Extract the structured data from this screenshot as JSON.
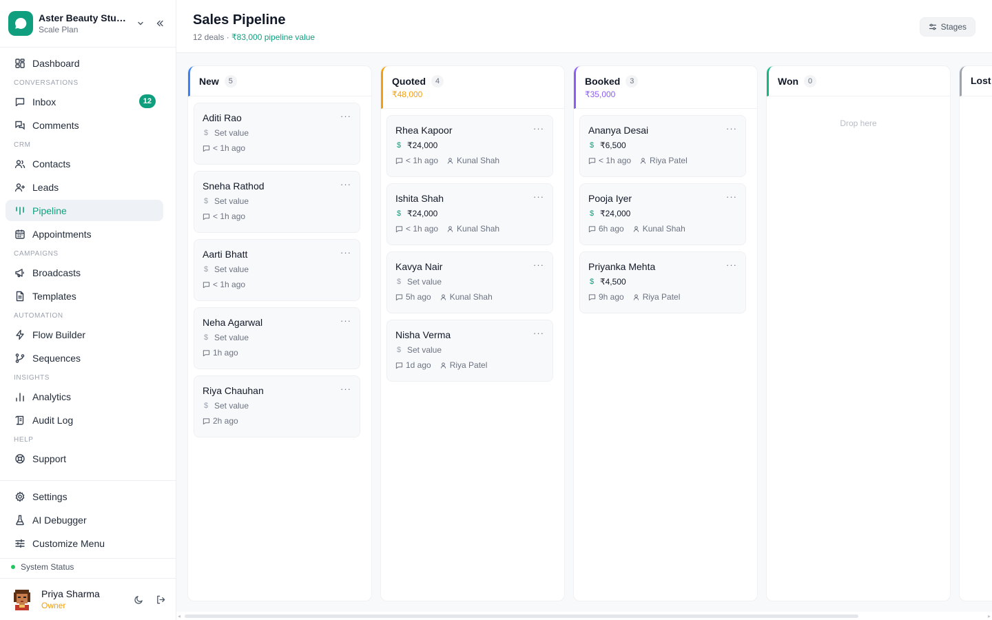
{
  "brand": {
    "name": "Aster Beauty Studio",
    "plan": "Scale Plan"
  },
  "nav": {
    "dashboard": "Dashboard",
    "sec_conversations": "CONVERSATIONS",
    "inbox": "Inbox",
    "inbox_badge": "12",
    "comments": "Comments",
    "sec_crm": "CRM",
    "contacts": "Contacts",
    "leads": "Leads",
    "pipeline": "Pipeline",
    "appointments": "Appointments",
    "sec_campaigns": "CAMPAIGNS",
    "broadcasts": "Broadcasts",
    "templates": "Templates",
    "sec_automation": "AUTOMATION",
    "flow_builder": "Flow Builder",
    "sequences": "Sequences",
    "sec_insights": "INSIGHTS",
    "analytics": "Analytics",
    "audit_log": "Audit Log",
    "sec_help": "HELP",
    "support": "Support",
    "settings": "Settings",
    "ai_debugger": "AI Debugger",
    "customize_menu": "Customize Menu"
  },
  "system_status": "System Status",
  "user": {
    "name": "Priya Sharma",
    "role": "Owner"
  },
  "header": {
    "title": "Sales Pipeline",
    "deals": "12 deals",
    "dot": " · ",
    "pipeline_value": "₹83,000 pipeline value",
    "stages_label": "Stages"
  },
  "columns": [
    {
      "title": "New",
      "count": "5",
      "total": "",
      "color": "#3b82f6",
      "drop_text": "",
      "cards": [
        {
          "name": "Aditi Rao",
          "value": "Set value",
          "time": "< 1h ago",
          "owner": ""
        },
        {
          "name": "Sneha Rathod",
          "value": "Set value",
          "time": "< 1h ago",
          "owner": ""
        },
        {
          "name": "Aarti Bhatt",
          "value": "Set value",
          "time": "< 1h ago",
          "owner": ""
        },
        {
          "name": "Neha Agarwal",
          "value": "Set value",
          "time": "1h ago",
          "owner": ""
        },
        {
          "name": "Riya Chauhan",
          "value": "Set value",
          "time": "2h ago",
          "owner": ""
        }
      ]
    },
    {
      "title": "Quoted",
      "count": "4",
      "total": "₹48,000",
      "color": "#f59e0b",
      "drop_text": "",
      "cards": [
        {
          "name": "Rhea Kapoor",
          "value": "₹24,000",
          "time": "< 1h ago",
          "owner": "Kunal Shah"
        },
        {
          "name": "Ishita Shah",
          "value": "₹24,000",
          "time": "< 1h ago",
          "owner": "Kunal Shah"
        },
        {
          "name": "Kavya Nair",
          "value": "Set value",
          "time": "5h ago",
          "owner": "Kunal Shah"
        },
        {
          "name": "Nisha Verma",
          "value": "Set value",
          "time": "1d ago",
          "owner": "Riya Patel"
        }
      ]
    },
    {
      "title": "Booked",
      "count": "3",
      "total": "₹35,000",
      "color": "#8b5cf6",
      "drop_text": "",
      "cards": [
        {
          "name": "Ananya Desai",
          "value": "₹6,500",
          "time": "< 1h ago",
          "owner": "Riya Patel"
        },
        {
          "name": "Pooja Iyer",
          "value": "₹24,000",
          "time": "6h ago",
          "owner": "Kunal Shah"
        },
        {
          "name": "Priyanka Mehta",
          "value": "₹4,500",
          "time": "9h ago",
          "owner": "Riya Patel"
        }
      ]
    },
    {
      "title": "Won",
      "count": "0",
      "total": "",
      "color": "#10b981",
      "drop_text": "Drop here",
      "cards": []
    },
    {
      "title": "Lost",
      "count": "",
      "total": "",
      "color": "#9ca3af",
      "drop_text": "",
      "cards": []
    }
  ],
  "colors": {
    "accent": "#0f9f7f",
    "owner_role": "#f59e0b"
  }
}
